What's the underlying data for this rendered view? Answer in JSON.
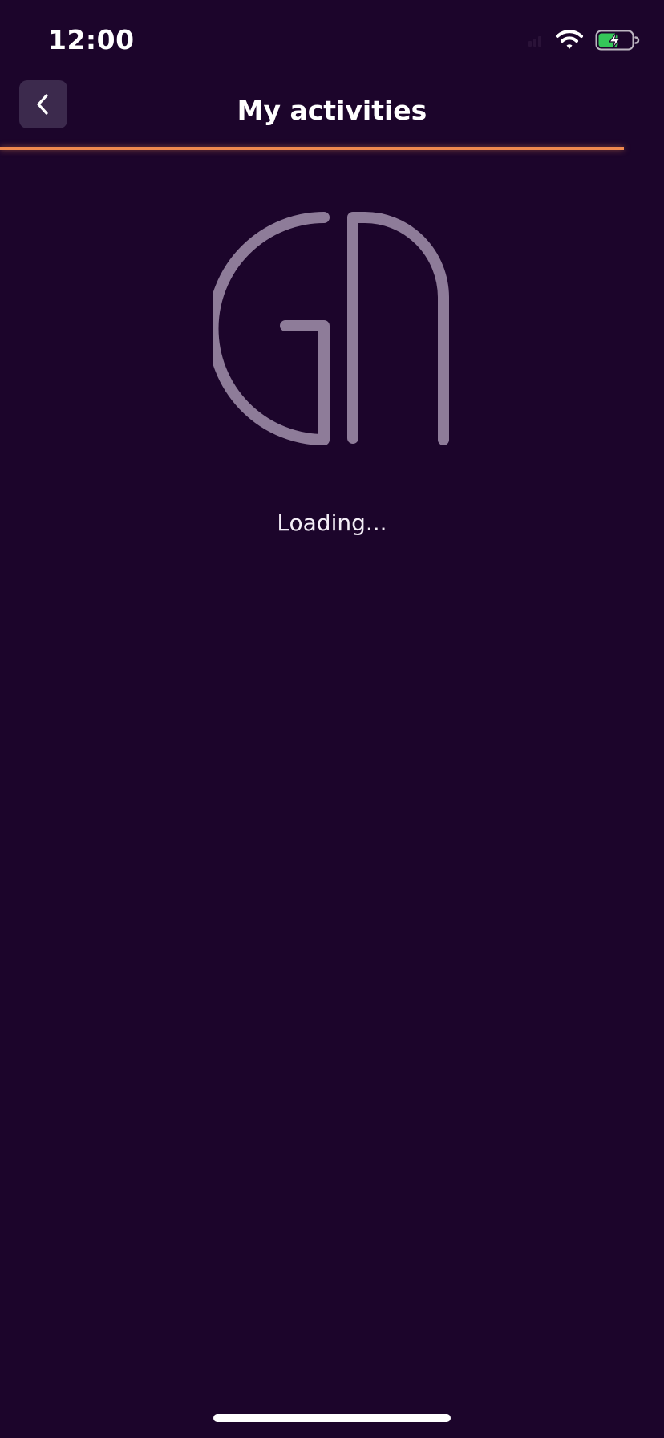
{
  "status_bar": {
    "time": "12:00",
    "signal_icon": "cellular-signal-icon",
    "wifi_icon": "wifi-icon",
    "battery_icon": "battery-charging-icon",
    "battery_level": 0.6,
    "battery_color": "#34c759"
  },
  "header": {
    "back_icon": "chevron-left-icon",
    "title": "My activities",
    "progress": 0.94,
    "progress_color": "#f0894f"
  },
  "main": {
    "logo_letters": "GA",
    "logo_color": "#8e7c99",
    "loading_text": "Loading..."
  },
  "theme": {
    "background": "#1c052b",
    "back_button_bg": "#3c2a4d"
  }
}
